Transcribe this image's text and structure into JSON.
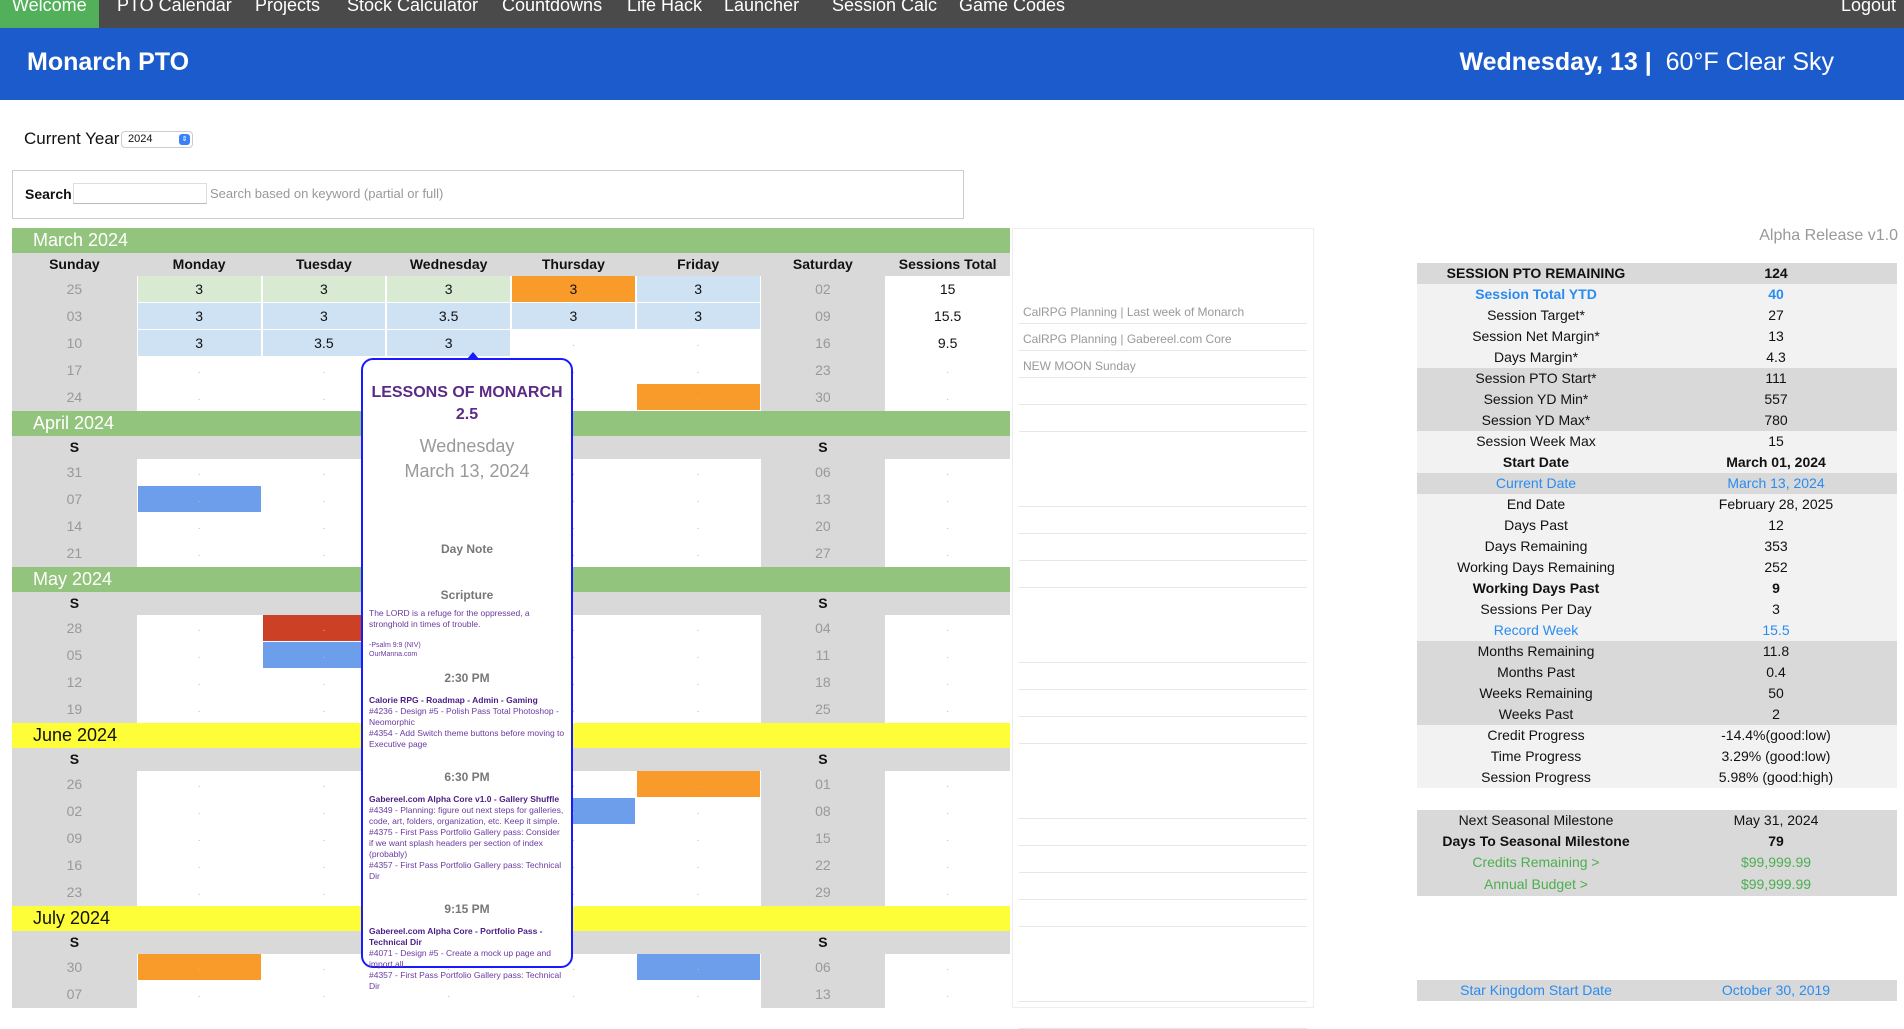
{
  "nav": {
    "items": [
      "Welcome",
      "PTO Calendar",
      "Projects",
      "Stock Calculator",
      "Countdowns",
      "Life Hack",
      "Launcher",
      "Session Calc",
      "Game Codes"
    ],
    "active": "Welcome",
    "logout": "Logout"
  },
  "header": {
    "title": "Monarch PTO",
    "day": "Wednesday, 13 |",
    "weather": "60°F Clear Sky"
  },
  "year": {
    "label": "Current Year:",
    "value": "2024"
  },
  "search": {
    "label": "Search",
    "value": "",
    "hint": "Search based on keyword (partial or full)"
  },
  "colors": {
    "green": "#93c47d",
    "yellow": "#fdfd38",
    "lightgreen": "#d9ead3",
    "lightblue": "#cfe2f3",
    "orange": "#f99b2a",
    "blue": "#6d9eeb",
    "red": "#cc4125"
  },
  "calendar": {
    "full_headers": [
      "Sunday",
      "Monday",
      "Tuesday",
      "Wednesday",
      "Thursday",
      "Friday",
      "Saturday",
      "Sessions Total"
    ],
    "short_headers": [
      "S",
      "",
      "",
      "",
      "",
      "",
      "S",
      ""
    ],
    "months": [
      {
        "name": "March 2024",
        "color": "green",
        "full": true,
        "weeks": [
          {
            "sun": "25",
            "days": [
              [
                "3",
                "lightgreen"
              ],
              [
                "3",
                "lightgreen"
              ],
              [
                "3",
                "lightgreen"
              ],
              [
                "3",
                "orange"
              ],
              [
                "3",
                "lightblue"
              ]
            ],
            "sat": "02",
            "total": "15"
          },
          {
            "sun": "03",
            "days": [
              [
                "3",
                "lightblue"
              ],
              [
                "3",
                "lightblue"
              ],
              [
                "3.5",
                "lightblue"
              ],
              [
                "3",
                "lightblue"
              ],
              [
                "3",
                "lightblue"
              ]
            ],
            "sat": "09",
            "total": "15.5"
          },
          {
            "sun": "10",
            "days": [
              [
                "3",
                "lightblue"
              ],
              [
                "3.5",
                "lightblue"
              ],
              [
                "3",
                "lightblue"
              ],
              [
                ".",
                ""
              ],
              [
                ".",
                ""
              ]
            ],
            "sat": "16",
            "total": "9.5"
          },
          {
            "sun": "17",
            "days": [
              [
                ".",
                ""
              ],
              [
                ".",
                ""
              ],
              [
                ".",
                ""
              ],
              [
                ".",
                ""
              ],
              [
                ".",
                ""
              ]
            ],
            "sat": "23",
            "total": "."
          },
          {
            "sun": "24",
            "days": [
              [
                ".",
                ""
              ],
              [
                ".",
                ""
              ],
              [
                ".",
                ""
              ],
              [
                ".",
                ""
              ],
              [
                ".",
                "orange"
              ]
            ],
            "sat": "30",
            "total": "."
          }
        ]
      },
      {
        "name": "April 2024",
        "color": "green",
        "full": false,
        "weeks": [
          {
            "sun": "31",
            "days": [
              [
                ".",
                ""
              ],
              [
                ".",
                ""
              ],
              [
                ".",
                ""
              ],
              [
                ".",
                ""
              ],
              [
                ".",
                ""
              ]
            ],
            "sat": "06",
            "total": "."
          },
          {
            "sun": "07",
            "days": [
              [
                ".",
                "blue"
              ],
              [
                ".",
                ""
              ],
              [
                ".",
                ""
              ],
              [
                ".",
                ""
              ],
              [
                ".",
                ""
              ]
            ],
            "sat": "13",
            "total": "."
          },
          {
            "sun": "14",
            "days": [
              [
                ".",
                ""
              ],
              [
                ".",
                ""
              ],
              [
                ".",
                ""
              ],
              [
                ".",
                ""
              ],
              [
                ".",
                ""
              ]
            ],
            "sat": "20",
            "total": "."
          },
          {
            "sun": "21",
            "days": [
              [
                ".",
                ""
              ],
              [
                ".",
                ""
              ],
              [
                ".",
                ""
              ],
              [
                ".",
                ""
              ],
              [
                ".",
                ""
              ]
            ],
            "sat": "27",
            "total": "."
          }
        ]
      },
      {
        "name": "May 2024",
        "color": "green",
        "full": false,
        "weeks": [
          {
            "sun": "28",
            "days": [
              [
                ".",
                ""
              ],
              [
                ".",
                "red"
              ],
              [
                ".",
                ""
              ],
              [
                ".",
                ""
              ],
              [
                ".",
                ""
              ]
            ],
            "sat": "04",
            "total": "."
          },
          {
            "sun": "05",
            "days": [
              [
                ".",
                ""
              ],
              [
                ".",
                "blue"
              ],
              [
                ".",
                ""
              ],
              [
                ".",
                ""
              ],
              [
                ".",
                ""
              ]
            ],
            "sat": "11",
            "total": "."
          },
          {
            "sun": "12",
            "days": [
              [
                ".",
                ""
              ],
              [
                ".",
                ""
              ],
              [
                ".",
                ""
              ],
              [
                ".",
                ""
              ],
              [
                ".",
                ""
              ]
            ],
            "sat": "18",
            "total": "."
          },
          {
            "sun": "19",
            "days": [
              [
                ".",
                ""
              ],
              [
                ".",
                ""
              ],
              [
                ".",
                ""
              ],
              [
                ".",
                ""
              ],
              [
                ".",
                ""
              ]
            ],
            "sat": "25",
            "total": "."
          }
        ]
      },
      {
        "name": "June 2024",
        "color": "yellow",
        "full": false,
        "weeks": [
          {
            "sun": "26",
            "days": [
              [
                ".",
                ""
              ],
              [
                ".",
                ""
              ],
              [
                ".",
                ""
              ],
              [
                ".",
                ""
              ],
              [
                ".",
                "orange"
              ]
            ],
            "sat": "01",
            "total": "."
          },
          {
            "sun": "02",
            "days": [
              [
                ".",
                ""
              ],
              [
                ".",
                ""
              ],
              [
                ".",
                ""
              ],
              [
                ".",
                "blue"
              ],
              [
                ".",
                ""
              ]
            ],
            "sat": "08",
            "total": "."
          },
          {
            "sun": "09",
            "days": [
              [
                ".",
                ""
              ],
              [
                ".",
                ""
              ],
              [
                ".",
                ""
              ],
              [
                ".",
                ""
              ],
              [
                ".",
                ""
              ]
            ],
            "sat": "15",
            "total": "."
          },
          {
            "sun": "16",
            "days": [
              [
                ".",
                ""
              ],
              [
                ".",
                ""
              ],
              [
                ".",
                ""
              ],
              [
                ".",
                ""
              ],
              [
                ".",
                ""
              ]
            ],
            "sat": "22",
            "total": "."
          },
          {
            "sun": "23",
            "days": [
              [
                ".",
                ""
              ],
              [
                ".",
                ""
              ],
              [
                ".",
                ""
              ],
              [
                ".",
                ""
              ],
              [
                ".",
                ""
              ]
            ],
            "sat": "29",
            "total": "."
          }
        ]
      },
      {
        "name": "July 2024",
        "color": "yellow",
        "full": false,
        "weeks": [
          {
            "sun": "30",
            "days": [
              [
                ".",
                "orange"
              ],
              [
                ".",
                ""
              ],
              [
                ".",
                ""
              ],
              [
                ".",
                ""
              ],
              [
                ".",
                "blue"
              ]
            ],
            "sat": "06",
            "total": "."
          },
          {
            "sun": "07",
            "days": [
              [
                ".",
                ""
              ],
              [
                ".",
                ""
              ],
              [
                ".",
                ""
              ],
              [
                ".",
                ""
              ],
              [
                ".",
                ""
              ]
            ],
            "sat": "13",
            "total": "."
          }
        ]
      }
    ]
  },
  "notes": [
    "CalRPG Planning  | Last week of Monarch",
    "CalRPG Planning  | Gabereel.com Core",
    "NEW MOON Sunday"
  ],
  "popup": {
    "title": "LESSONS OF MONARCH 2.5",
    "weekday": "Wednesday",
    "date": "March 13, 2024",
    "day_note": "Day Note",
    "scripture_heading": "Scripture",
    "scripture": "The LORD is a refuge for the oppressed, a stronghold in times of trouble.",
    "reference": "-Psalm 9:9 (NIV)",
    "source": "OurManna.com",
    "slots": [
      {
        "time": "2:30 PM",
        "project": "Calorie RPG - Roadmap - Admin - Gaming",
        "tasks": [
          "#4236 - Design #5 - Polish Pass Total Photoshop - Neomorphic",
          "#4354 - Add Switch theme buttons before moving to Executive page"
        ]
      },
      {
        "time": "6:30 PM",
        "project": "Gabereel.com Alpha Core v1.0 - Gallery Shuffle",
        "tasks": [
          "#4349 - Planning: figure out next steps for galleries, code, art, folders, organization, etc. Keep it simple.",
          "#4375 - First Pass Portfolio Gallery pass: Consider if we want splash headers per section of index (probably)",
          "#4357 - First Pass Portfolio Gallery pass: Technical Dir"
        ]
      },
      {
        "time": "9:15 PM",
        "project": "Gabereel.com Alpha Core - Portfolio Pass - Technical Dir",
        "tasks": [
          "#4071 - Design #5 - Create a mock up page and import all",
          "#4357 - First Pass Portfolio Gallery pass: Technical Dir"
        ]
      }
    ]
  },
  "release": "Alpha Release v1.0",
  "stats": [
    {
      "l": "SESSION PTO REMAINING",
      "v": "124",
      "bg": "g",
      "s": "b"
    },
    {
      "l": "Session Total YTD",
      "v": "40",
      "bg": "lt",
      "s": "b bl"
    },
    {
      "l": "Session Target*",
      "v": "27",
      "bg": "lt",
      "s": ""
    },
    {
      "l": "Session Net Margin*",
      "v": "13",
      "bg": "lt",
      "s": ""
    },
    {
      "l": "Days Margin*",
      "v": "4.3",
      "bg": "lt",
      "s": ""
    },
    {
      "l": "Session PTO Start*",
      "v": "111",
      "bg": "g",
      "s": ""
    },
    {
      "l": "Session YD Min*",
      "v": "557",
      "bg": "g",
      "s": ""
    },
    {
      "l": "Session YD Max*",
      "v": "780",
      "bg": "g",
      "s": ""
    },
    {
      "l": "Session Week Max",
      "v": "15",
      "bg": "lt",
      "s": ""
    },
    {
      "l": "Start Date",
      "v": "March 01, 2024",
      "bg": "lt",
      "s": "b"
    },
    {
      "l": "Current Date",
      "v": "March 13, 2024",
      "bg": "g",
      "s": "bl"
    },
    {
      "l": "End Date",
      "v": "February 28, 2025",
      "bg": "lt",
      "s": ""
    },
    {
      "l": "Days Past",
      "v": "12",
      "bg": "lt",
      "s": ""
    },
    {
      "l": "Days Remaining",
      "v": "353",
      "bg": "lt",
      "s": ""
    },
    {
      "l": "Working Days Remaining",
      "v": "252",
      "bg": "lt",
      "s": ""
    },
    {
      "l": "Working Days Past",
      "v": "9",
      "bg": "lt",
      "s": "b"
    },
    {
      "l": "Sessions Per Day",
      "v": "3",
      "bg": "lt",
      "s": ""
    },
    {
      "l": "Record Week",
      "v": "15.5",
      "bg": "lt",
      "s": "bl"
    },
    {
      "l": "Months Remaining",
      "v": "11.8",
      "bg": "g",
      "s": ""
    },
    {
      "l": "Months Past",
      "v": "0.4",
      "bg": "g",
      "s": ""
    },
    {
      "l": "Weeks Remaining",
      "v": "50",
      "bg": "g",
      "s": ""
    },
    {
      "l": "Weeks Past",
      "v": "2",
      "bg": "g",
      "s": ""
    },
    {
      "l": "Credit Progress",
      "v": "-14.4%(good:low)",
      "bg": "lt",
      "s": ""
    },
    {
      "l": "Time Progress",
      "v": "3.29% (good:low)",
      "bg": "lt",
      "s": ""
    },
    {
      "l": "Session Progress",
      "v": "5.98% (good:high)",
      "bg": "lt",
      "s": ""
    }
  ],
  "milestones": [
    {
      "l": "Next Seasonal Milestone",
      "v": "May 31, 2024",
      "bg": "g",
      "s": ""
    },
    {
      "l": "Days To Seasonal Milestone",
      "v": "79",
      "bg": "g",
      "s": "b"
    },
    {
      "l": "Credits Remaining >",
      "v": "$99,999.99",
      "bg": "g",
      "s": "gr"
    },
    {
      "l": "Annual Budget >",
      "v": "$99,999.99",
      "bg": "g",
      "s": "gr"
    }
  ],
  "kingdom": [
    {
      "l": "Star Kingdom Start Date",
      "v": "October 30, 2019",
      "bg": "g",
      "s": "bl"
    }
  ]
}
